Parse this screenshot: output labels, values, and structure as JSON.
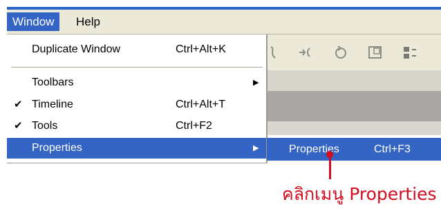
{
  "menubar": {
    "items": [
      {
        "label": "Window",
        "active": true
      },
      {
        "label": "Help",
        "active": false
      }
    ]
  },
  "window_menu": {
    "items": [
      {
        "label": "Duplicate Window",
        "shortcut": "Ctrl+Alt+K",
        "checked": false,
        "submenu": false
      },
      {
        "label": "Toolbars",
        "shortcut": "",
        "checked": false,
        "submenu": true
      },
      {
        "label": "Timeline",
        "shortcut": "Ctrl+Alt+T",
        "checked": true,
        "submenu": false
      },
      {
        "label": "Tools",
        "shortcut": "Ctrl+F2",
        "checked": true,
        "submenu": false
      },
      {
        "label": "Properties",
        "shortcut": "",
        "checked": false,
        "submenu": true,
        "highlighted": true
      }
    ],
    "check_glyph": "✔",
    "arrow_glyph": "▶"
  },
  "properties_submenu": {
    "label": "Properties",
    "shortcut": "Ctrl+F3"
  },
  "toolbar_icons": [
    "straighten-icon",
    "smooth-icon",
    "rotate-icon",
    "scale-icon",
    "align-icon"
  ],
  "annotation": {
    "text": "คลิกเมนู Properties",
    "color": "#d40c1f"
  },
  "colors": {
    "accent": "#3565c4",
    "menu_bg": "#ece9d8"
  }
}
